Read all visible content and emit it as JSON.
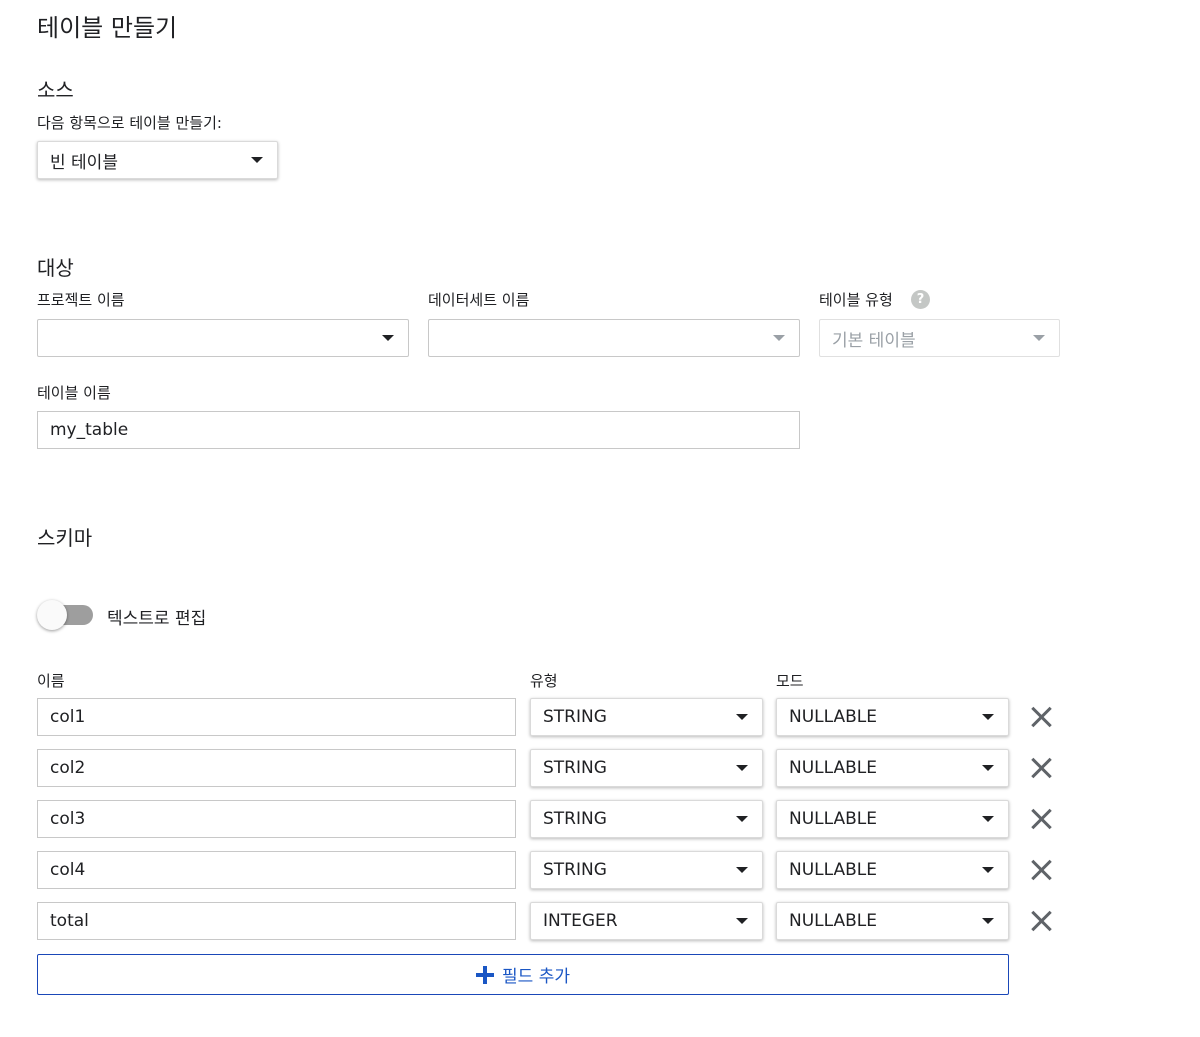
{
  "page_title": "테이블 만들기",
  "source": {
    "heading": "소스",
    "create_from_label": "다음 항목으로 테이블 만들기:",
    "create_from_value": "빈 테이블"
  },
  "destination": {
    "heading": "대상",
    "project_label": "프로젝트 이름",
    "project_value": "",
    "dataset_label": "데이터세트 이름",
    "dataset_value": "",
    "table_type_label": "테이블 유형",
    "table_type_help": "?",
    "table_type_value": "기본 테이블",
    "table_name_label": "테이블 이름",
    "table_name_value": "my_table"
  },
  "schema": {
    "heading": "스키마",
    "edit_as_text_label": "텍스트로 편집",
    "edit_as_text_on": false,
    "col_name_header": "이름",
    "col_type_header": "유형",
    "col_mode_header": "모드",
    "fields": [
      {
        "name": "col1",
        "type": "STRING",
        "mode": "NULLABLE"
      },
      {
        "name": "col2",
        "type": "STRING",
        "mode": "NULLABLE"
      },
      {
        "name": "col3",
        "type": "STRING",
        "mode": "NULLABLE"
      },
      {
        "name": "col4",
        "type": "STRING",
        "mode": "NULLABLE"
      },
      {
        "name": "total",
        "type": "INTEGER",
        "mode": "NULLABLE"
      }
    ],
    "add_field_label": "필드 추가"
  },
  "icons": {
    "dropdown": "caret-down-icon",
    "help": "help-circle-icon",
    "delete": "close-icon",
    "add": "plus-icon"
  },
  "colors": {
    "accent": "#1a56c4",
    "toggle_off": "#9e9e9e",
    "icon_grey": "#5f6368"
  }
}
